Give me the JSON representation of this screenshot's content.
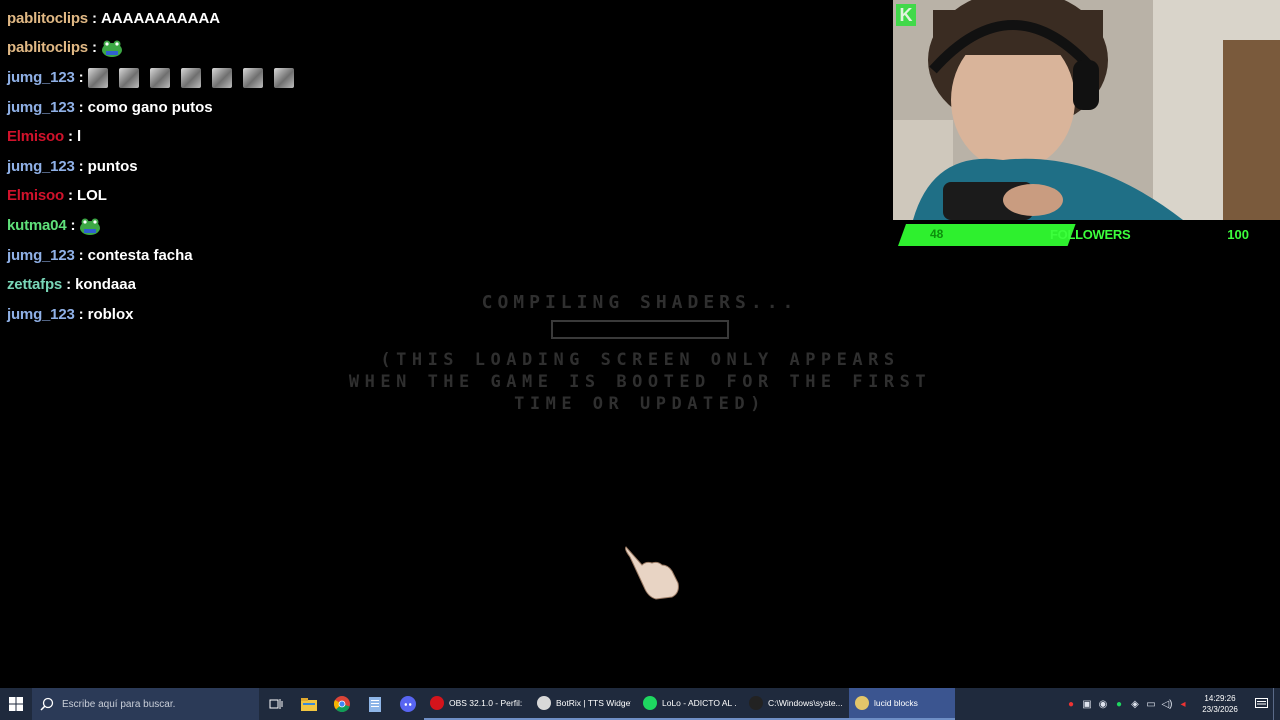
{
  "chat": [
    {
      "user": "pablitoclips",
      "color": "#e0b884",
      "text": "AAAAAAAAAAA",
      "emotes": []
    },
    {
      "user": "pablitoclips",
      "color": "#e0b884",
      "text": "",
      "emotes": [
        "frog"
      ]
    },
    {
      "user": "jumg_123",
      "color": "#8fb0e6",
      "text": "",
      "emotes": [
        "wolf",
        "wolf",
        "wolf",
        "wolf",
        "wolf",
        "wolf",
        "wolf"
      ]
    },
    {
      "user": "jumg_123",
      "color": "#8fb0e6",
      "text": "como gano putos",
      "emotes": []
    },
    {
      "user": "Elmisoo",
      "color": "#d0122b",
      "text": "l",
      "emotes": []
    },
    {
      "user": "jumg_123",
      "color": "#8fb0e6",
      "text": "puntos",
      "emotes": []
    },
    {
      "user": "Elmisoo",
      "color": "#d0122b",
      "text": "LOL",
      "emotes": []
    },
    {
      "user": "kutma04",
      "color": "#5fe07a",
      "text": "",
      "emotes": [
        "frog"
      ]
    },
    {
      "user": "jumg_123",
      "color": "#8fb0e6",
      "text": "contesta facha",
      "emotes": []
    },
    {
      "user": "zettafps",
      "color": "#79d6b8",
      "text": "kondaaa",
      "emotes": []
    },
    {
      "user": "jumg_123",
      "color": "#8fb0e6",
      "text": "roblox",
      "emotes": []
    }
  ],
  "loading": {
    "title": "COMPILING SHADERS...",
    "note": "(THIS LOADING SCREEN ONLY APPEARS WHEN THE GAME IS BOOTED FOR THE FIRST TIME OR UPDATED)"
  },
  "followers": {
    "current": "48",
    "label": "FOLLOWERS",
    "goal": "100",
    "progress": 0.48,
    "color": "#2ef02e"
  },
  "webcam": {
    "badge": "K"
  },
  "taskbar": {
    "search_placeholder": "Escribe aquí para buscar.",
    "apps": [
      {
        "label": "OBS 32.1.0 - Perfil: ...",
        "icon_color": "#d4141c",
        "icon": "obs-icon"
      },
      {
        "label": "BotRix | TTS Widget...",
        "icon_color": "#d8d8d8",
        "icon": "botrix-icon"
      },
      {
        "label": "LoLo - ADICTO AL ...",
        "icon_color": "#1ed760",
        "icon": "spotify-icon"
      },
      {
        "label": "C:\\Windows\\syste...",
        "icon_color": "#222222",
        "icon": "cmd-icon"
      },
      {
        "label": "lucid blocks",
        "icon_color": "#e3c66a",
        "icon": "lucid-blocks-icon"
      }
    ],
    "time": "14:29:26",
    "date": "23/3/2026"
  }
}
